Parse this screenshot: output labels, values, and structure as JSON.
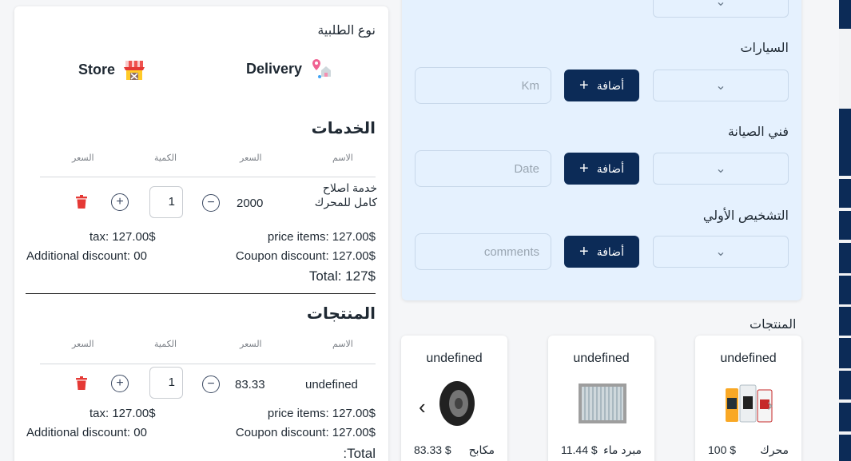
{
  "order_type": {
    "label": "نوع الطلبية",
    "options": [
      {
        "label": "Store",
        "icon": "store-icon"
      },
      {
        "label": "Delivery",
        "icon": "delivery-location-icon"
      }
    ]
  },
  "services": {
    "title": "الخدمات",
    "columns": {
      "name": "الاسم",
      "price": "السعر",
      "quantity": "الكمية",
      "price2": "السعر"
    },
    "rows": [
      {
        "name": "خدمة اصلاح كامل للمحرك",
        "price": "2000",
        "quantity": "1"
      }
    ],
    "summary": {
      "price_items": "price items: 127.00$",
      "tax": "tax: 127.00$",
      "coupon": "Coupon discount: 127.00$",
      "additional": "Additional discount: 00",
      "total": "Total: 127$"
    }
  },
  "products": {
    "title": "المنتجات",
    "columns": {
      "name": "الاسم",
      "price": "السعر",
      "quantity": "الكمية",
      "price2": "السعر"
    },
    "rows": [
      {
        "name": "undefined",
        "price": "83.33",
        "quantity": "1"
      }
    ],
    "summary": {
      "price_items": "price items: 127.00$",
      "tax": "tax: 127.00$",
      "coupon": "Coupon discount: 127.00$",
      "additional": "Additional discount: 00",
      "total": ":Total"
    }
  },
  "form": {
    "cars_label": "السيارات",
    "technician_label": "فني الصيانة",
    "diagnosis_label": "التشخيص الأولي",
    "add_label": "أضافة",
    "km_placeholder": "Km",
    "date_placeholder": "Date",
    "comments_placeholder": "comments"
  },
  "catalog": {
    "title": "المنتجات",
    "items": [
      {
        "name": "undefined",
        "category": "محرك",
        "price": "100 $",
        "icon": "engine-oil-icon"
      },
      {
        "name": "undefined",
        "category": "مبرد ماء",
        "price": "11.44 $",
        "icon": "radiator-icon"
      },
      {
        "name": "undefined",
        "category": "مكابح",
        "price": "83.33 $",
        "icon": "tire-icon"
      }
    ]
  },
  "colors": {
    "primary": "#0c2b57",
    "panel": "#e5f1fe",
    "danger": "#e53935"
  }
}
